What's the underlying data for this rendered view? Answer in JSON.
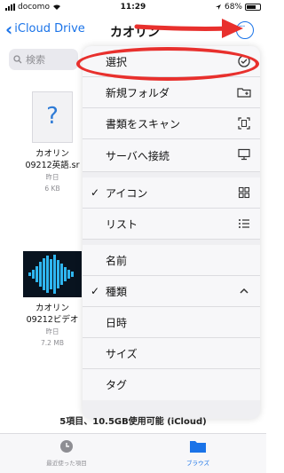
{
  "status_bar": {
    "carrier": "docomo",
    "time": "11:29",
    "battery": "68%"
  },
  "nav": {
    "back_label": "iCloud Drive",
    "title": "カオリン"
  },
  "search": {
    "placeholder": "検索"
  },
  "files": [
    {
      "name_line1": "カオリン",
      "name_line2": "09212英語.sr",
      "date": "昨日",
      "size": "6 KB"
    },
    {
      "name_line1": "カオリン",
      "name_line2": "09212ビデオ",
      "date": "昨日",
      "size": "7.2 MB"
    }
  ],
  "menu": {
    "items": [
      {
        "label": "選択",
        "icon": "checkmark-circle-icon"
      },
      {
        "label": "新規フォルダ",
        "icon": "folder-plus-icon"
      },
      {
        "label": "書類をスキャン",
        "icon": "scan-icon"
      },
      {
        "label": "サーバへ接続",
        "icon": "monitor-icon"
      },
      {
        "label": "アイコン",
        "icon": "grid-icon",
        "checked": true
      },
      {
        "label": "リスト",
        "icon": "list-icon"
      },
      {
        "label": "名前"
      },
      {
        "label": "種類",
        "checked": true,
        "expanded": true
      },
      {
        "label": "日時"
      },
      {
        "label": "サイズ"
      },
      {
        "label": "タグ"
      }
    ]
  },
  "footer": {
    "item_count": "5項目、10.5GB使用可能 (iCloud)"
  },
  "tabs": [
    {
      "label": "最近使った項目",
      "icon": "clock-icon",
      "active": false
    },
    {
      "label": "ブラウズ",
      "icon": "folder-icon",
      "active": true
    }
  ],
  "colors": {
    "accent": "#1a73e8",
    "annotation": "#e8302d"
  }
}
